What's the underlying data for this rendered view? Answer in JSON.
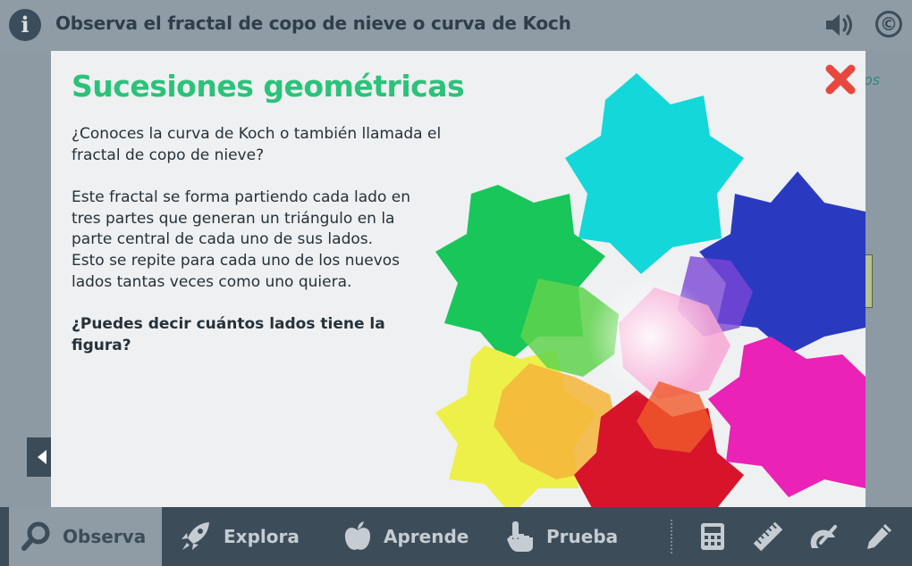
{
  "header": {
    "title": "Observa el fractal de copo de nieve o curva de Koch",
    "info_icon_glyph": "i",
    "copyright_glyph": "©"
  },
  "background": {
    "link_fragment": "os"
  },
  "modal": {
    "title": "Sucesiones geométricas",
    "paragraph1": "¿Conoces la curva de Koch o también llamada el fractal de copo de nieve?",
    "paragraph2_lines": [
      "Este fractal se forma partiendo cada lado en",
      "tres partes que generan un triángulo en la",
      "parte central de cada uno de sus lados.",
      "Esto se repite para cada uno de los nuevos",
      "lados tantas veces como uno quiera."
    ],
    "question": "¿Puedes decir cuántos lados tiene la figura?",
    "colors": {
      "title": "#2bc27a",
      "close": "#e8473f"
    }
  },
  "toolbar": {
    "tabs": [
      {
        "label": "Observa",
        "icon": "search-icon",
        "active": true
      },
      {
        "label": "Explora",
        "icon": "rocket-icon",
        "active": false
      },
      {
        "label": "Aprende",
        "icon": "apple-icon",
        "active": false
      },
      {
        "label": "Prueba",
        "icon": "hand-pointer-icon",
        "active": false
      }
    ],
    "utilities": [
      "calculator-icon",
      "ruler-icon",
      "protractor-icon",
      "pencil-icon"
    ]
  }
}
